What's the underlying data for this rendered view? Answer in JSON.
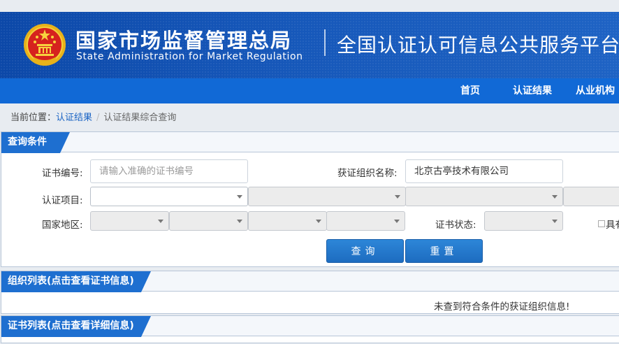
{
  "header": {
    "agency_cn": "国家市场监督管理总局",
    "agency_en": "State Administration  for  Market Regulation",
    "platform": "全国认证认可信息公共服务平台"
  },
  "nav": {
    "items": [
      "首页",
      "认证结果",
      "从业机构"
    ]
  },
  "breadcrumb": {
    "prefix": "当前位置：",
    "link": "认证结果",
    "separator": "/",
    "current": "认证结果综合查询"
  },
  "query": {
    "title": "查询条件",
    "cert_no_label": "证书编号:",
    "cert_no_placeholder": "请输入准确的证书编号",
    "org_label": "获证组织名称:",
    "org_value": "北京古亭技术有限公司",
    "project_label": "认证项目:",
    "region_label": "国家地区:",
    "status_label": "证书状态:",
    "checkbox_label": "具有",
    "search_button": "查询",
    "reset_button": "重置"
  },
  "org_list": {
    "title": "组织列表(点击查看证书信息)",
    "empty_message": "未查到符合条件的获证组织信息!"
  },
  "cert_list": {
    "title": "证书列表(点击查看详细信息)"
  },
  "colors": {
    "header_blue": "#1556b8",
    "nav_blue": "#1169d6",
    "tab_blue": "#1e6fd0",
    "link_blue": "#1a63c4"
  }
}
